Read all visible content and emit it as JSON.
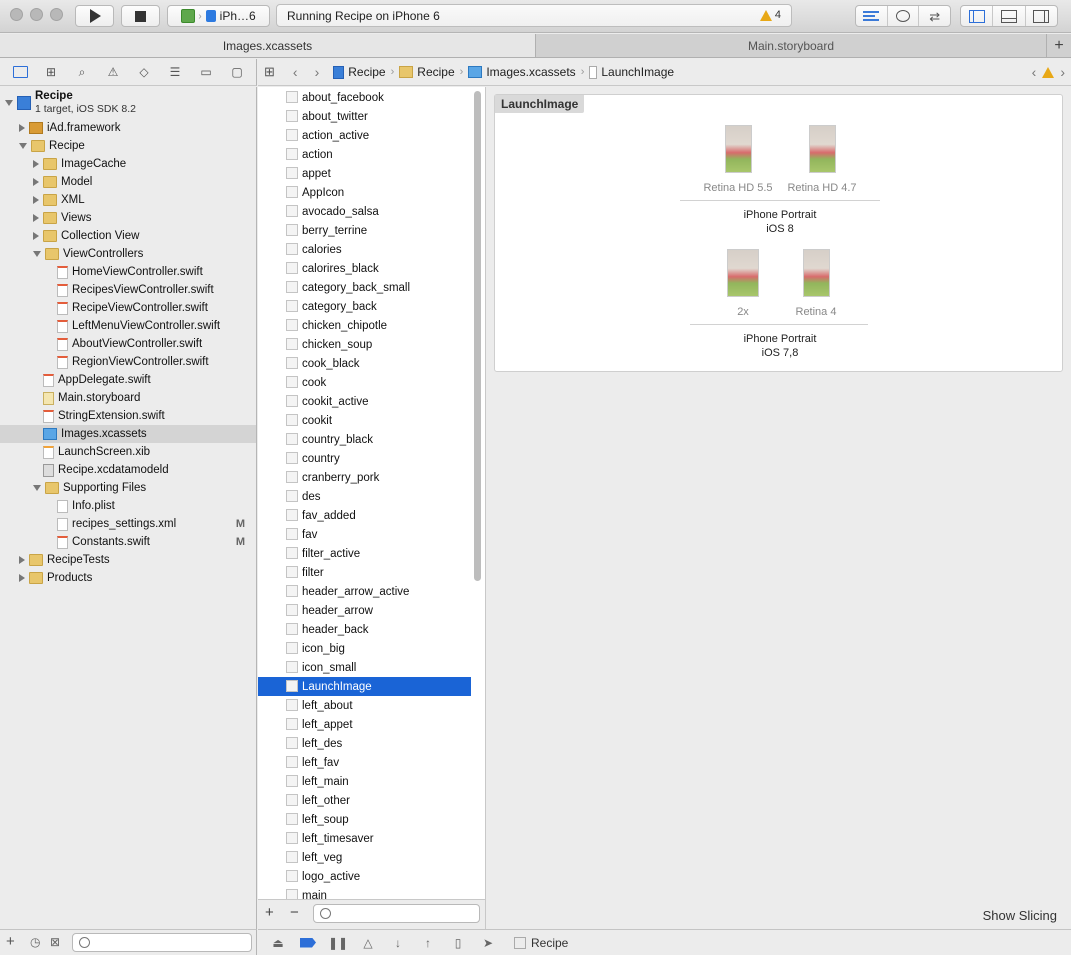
{
  "toolbar": {
    "scheme_name": "iPh…6",
    "activity_text": "Running Recipe on iPhone 6",
    "warning_count": "4"
  },
  "tabs": [
    {
      "label": "Images.xcassets"
    },
    {
      "label": "Main.storyboard"
    }
  ],
  "navigator": {
    "project": {
      "name": "Recipe",
      "subtitle": "1 target, iOS SDK 8.2"
    },
    "items": [
      {
        "label": "iAd.framework",
        "indent": 1,
        "disc": "closed",
        "icon": "framework"
      },
      {
        "label": "Recipe",
        "indent": 1,
        "disc": "open",
        "icon": "folder"
      },
      {
        "label": "ImageCache",
        "indent": 2,
        "disc": "closed",
        "icon": "folder"
      },
      {
        "label": "Model",
        "indent": 2,
        "disc": "closed",
        "icon": "folder"
      },
      {
        "label": "XML",
        "indent": 2,
        "disc": "closed",
        "icon": "folder"
      },
      {
        "label": "Views",
        "indent": 2,
        "disc": "closed",
        "icon": "folder"
      },
      {
        "label": "Collection View",
        "indent": 2,
        "disc": "closed",
        "icon": "folder"
      },
      {
        "label": "ViewControllers",
        "indent": 2,
        "disc": "open",
        "icon": "folder"
      },
      {
        "label": "HomeViewController.swift",
        "indent": 3,
        "disc": "none",
        "icon": "swift"
      },
      {
        "label": "RecipesViewController.swift",
        "indent": 3,
        "disc": "none",
        "icon": "swift"
      },
      {
        "label": "RecipeViewController.swift",
        "indent": 3,
        "disc": "none",
        "icon": "swift"
      },
      {
        "label": "LeftMenuViewController.swift",
        "indent": 3,
        "disc": "none",
        "icon": "swift"
      },
      {
        "label": "AboutViewController.swift",
        "indent": 3,
        "disc": "none",
        "icon": "swift"
      },
      {
        "label": "RegionViewController.swift",
        "indent": 3,
        "disc": "none",
        "icon": "swift"
      },
      {
        "label": "AppDelegate.swift",
        "indent": 2,
        "disc": "none",
        "icon": "swift"
      },
      {
        "label": "Main.storyboard",
        "indent": 2,
        "disc": "none",
        "icon": "sb"
      },
      {
        "label": "StringExtension.swift",
        "indent": 2,
        "disc": "none",
        "icon": "swift"
      },
      {
        "label": "Images.xcassets",
        "indent": 2,
        "disc": "none",
        "icon": "xcassets",
        "selected": true
      },
      {
        "label": "LaunchScreen.xib",
        "indent": 2,
        "disc": "none",
        "icon": "xib"
      },
      {
        "label": "Recipe.xcdatamodeld",
        "indent": 2,
        "disc": "none",
        "icon": "model"
      },
      {
        "label": "Supporting Files",
        "indent": 2,
        "disc": "open",
        "icon": "folder"
      },
      {
        "label": "Info.plist",
        "indent": 3,
        "disc": "none",
        "icon": "doc"
      },
      {
        "label": "recipes_settings.xml",
        "indent": 3,
        "disc": "none",
        "icon": "doc",
        "flag": "M"
      },
      {
        "label": "Constants.swift",
        "indent": 3,
        "disc": "none",
        "icon": "swift",
        "flag": "M"
      },
      {
        "label": "RecipeTests",
        "indent": 1,
        "disc": "closed",
        "icon": "folder"
      },
      {
        "label": "Products",
        "indent": 1,
        "disc": "closed",
        "icon": "folder"
      }
    ]
  },
  "jumpbar": {
    "crumbs": [
      "Recipe",
      "Recipe",
      "Images.xcassets",
      "LaunchImage"
    ]
  },
  "assets": [
    "about_facebook",
    "about_twitter",
    "action_active",
    "action",
    "appet",
    "AppIcon",
    "avocado_salsa",
    "berry_terrine",
    "calories",
    "calorires_black",
    "category_back_small",
    "category_back",
    "chicken_chipotle",
    "chicken_soup",
    "cook_black",
    "cook",
    "cookit_active",
    "cookit",
    "country_black",
    "country",
    "cranberry_pork",
    "des",
    "fav_added",
    "fav",
    "filter_active",
    "filter",
    "header_arrow_active",
    "header_arrow",
    "header_back",
    "icon_big",
    "icon_small",
    "LaunchImage",
    "left_about",
    "left_appet",
    "left_des",
    "left_fav",
    "left_main",
    "left_other",
    "left_soup",
    "left_timesaver",
    "left_veg",
    "logo_active",
    "main"
  ],
  "selected_asset": "LaunchImage",
  "editor": {
    "set_name": "LaunchImage",
    "groups": [
      {
        "slots": [
          "Retina HD 5.5",
          "Retina HD 4.7"
        ],
        "caption_line1": "iPhone Portrait",
        "caption_line2": "iOS 8"
      },
      {
        "slots": [
          "2x",
          "Retina 4"
        ],
        "caption_line1": "iPhone Portrait",
        "caption_line2": "iOS 7,8"
      }
    ],
    "show_slicing": "Show Slicing"
  },
  "debugbar": {
    "target_label": "Recipe"
  }
}
